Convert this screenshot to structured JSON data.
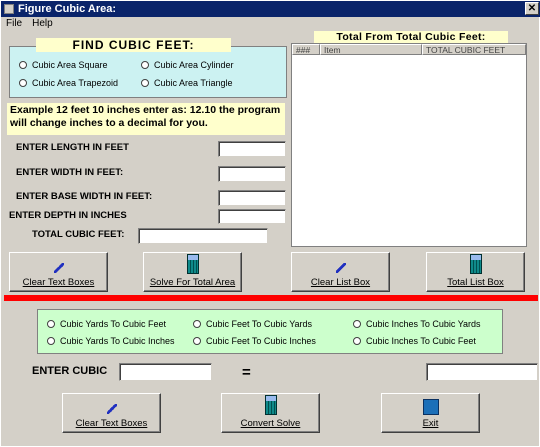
{
  "window": {
    "title": "Figure Cubic Area:",
    "close": "✕"
  },
  "menu": [
    "File",
    "Help"
  ],
  "find": {
    "heading": "FIND CUBIC FEET:",
    "options": [
      "Cubic Area Square",
      "Cubic Area Cylinder",
      "Cubic Area Trapezoid",
      "Cubic Area Triangle"
    ]
  },
  "example": "Example 12 feet 10 inches enter as: 12.10  the program will change inches to a decimal for you.",
  "fields": {
    "length": "ENTER LENGTH IN FEET",
    "width": "ENTER  WIDTH  IN FEET:",
    "base": "ENTER  BASE WIDTH  IN  FEET:",
    "depth": "ENTER  DEPTH  IN  INCHES",
    "total": "TOTAL  CUBIC FEET:"
  },
  "totals": {
    "heading": "Total From Total Cubic  Feet:",
    "columns": [
      "###",
      "Item",
      "TOTAL CUBIC FEET"
    ]
  },
  "buttons_top": [
    "Clear Text Boxes",
    "Solve For Total Area",
    "Clear List Box",
    "Total List Box"
  ],
  "convert": {
    "options": [
      "Cubic Yards To Cubic Feet",
      "Cubic Feet To Cubic  Yards",
      "Cubic Inches To Cubic Yards",
      "Cubic Yards To Cubic Inches",
      "Cubic Feet To Cubic Inches",
      "Cubic Inches To Cubic Feet"
    ],
    "enter_label": "ENTER CUBIC",
    "equals": "="
  },
  "buttons_bottom": [
    "Clear Text Boxes",
    "Convert Solve",
    "Exit"
  ],
  "colors": {
    "titlebar": "#0a246a",
    "panel": "#ccf2f2",
    "green": "#ccffcc",
    "yellow": "#ffffcc",
    "red": "#ff0000"
  }
}
